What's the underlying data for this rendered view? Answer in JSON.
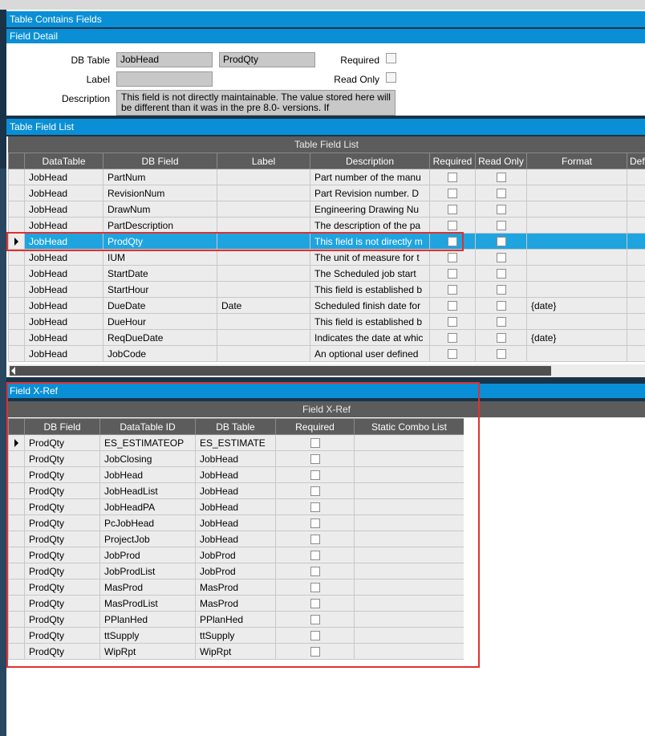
{
  "panels": {
    "main_title": "Table Contains Fields",
    "field_detail_title": "Field Detail",
    "table_field_list_title": "Table Field List",
    "field_xref_title": "Field X-Ref"
  },
  "field_detail": {
    "db_table_label": "DB Table",
    "db_table_value": "JobHead",
    "db_field_value": "ProdQty",
    "label_label": "Label",
    "label_value": "",
    "required_label": "Required",
    "read_only_label": "Read Only",
    "description_label": "Description",
    "description_value": "This field is not directly maintainable. The value stored here will be different than it was in the pre 8.0- versions. If"
  },
  "table_field_list": {
    "band_title": "Table Field List",
    "columns": [
      "DataTable",
      "DB Field",
      "Label",
      "Description",
      "Required",
      "Read Only",
      "Format",
      "Def"
    ],
    "rows": [
      {
        "datatable": "JobHead",
        "dbfield": "PartNum",
        "label": "",
        "description": "Part number of the manu",
        "format": ""
      },
      {
        "datatable": "JobHead",
        "dbfield": "RevisionNum",
        "label": "",
        "description": "Part Revision number.  D",
        "format": ""
      },
      {
        "datatable": "JobHead",
        "dbfield": "DrawNum",
        "label": "",
        "description": "Engineering Drawing Nu",
        "format": ""
      },
      {
        "datatable": "JobHead",
        "dbfield": "PartDescription",
        "label": "",
        "description": "The description of the pa",
        "format": ""
      },
      {
        "datatable": "JobHead",
        "dbfield": "ProdQty",
        "label": "",
        "description": "This field is not directly m",
        "format": ""
      },
      {
        "datatable": "JobHead",
        "dbfield": "IUM",
        "label": "",
        "description": "The unit of measure for t",
        "format": ""
      },
      {
        "datatable": "JobHead",
        "dbfield": "StartDate",
        "label": "",
        "description": "The Scheduled job start",
        "format": ""
      },
      {
        "datatable": "JobHead",
        "dbfield": "StartHour",
        "label": "",
        "description": "This field is established b",
        "format": ""
      },
      {
        "datatable": "JobHead",
        "dbfield": "DueDate",
        "label": "Date",
        "description": "Scheduled finish date for",
        "format": "{date}"
      },
      {
        "datatable": "JobHead",
        "dbfield": "DueHour",
        "label": "",
        "description": "This field is established b",
        "format": ""
      },
      {
        "datatable": "JobHead",
        "dbfield": "ReqDueDate",
        "label": "",
        "description": "Indicates the date at whic",
        "format": "{date}"
      },
      {
        "datatable": "JobHead",
        "dbfield": "JobCode",
        "label": "",
        "description": "An optional user defined",
        "format": ""
      }
    ]
  },
  "field_xref": {
    "band_title": "Field X-Ref",
    "columns": [
      "DB Field",
      "DataTable ID",
      "DB Table",
      "Required",
      "Static Combo List"
    ],
    "rows": [
      {
        "dbfield": "ProdQty",
        "datatable_id": "ES_ESTIMATEOP",
        "dbtable": "ES_ESTIMATE"
      },
      {
        "dbfield": "ProdQty",
        "datatable_id": "JobClosing",
        "dbtable": "JobHead"
      },
      {
        "dbfield": "ProdQty",
        "datatable_id": "JobHead",
        "dbtable": "JobHead"
      },
      {
        "dbfield": "ProdQty",
        "datatable_id": "JobHeadList",
        "dbtable": "JobHead"
      },
      {
        "dbfield": "ProdQty",
        "datatable_id": "JobHeadPA",
        "dbtable": "JobHead"
      },
      {
        "dbfield": "ProdQty",
        "datatable_id": "PcJobHead",
        "dbtable": "JobHead"
      },
      {
        "dbfield": "ProdQty",
        "datatable_id": "ProjectJob",
        "dbtable": "JobHead"
      },
      {
        "dbfield": "ProdQty",
        "datatable_id": "JobProd",
        "dbtable": "JobProd"
      },
      {
        "dbfield": "ProdQty",
        "datatable_id": "JobProdList",
        "dbtable": "JobProd"
      },
      {
        "dbfield": "ProdQty",
        "datatable_id": "MasProd",
        "dbtable": "MasProd"
      },
      {
        "dbfield": "ProdQty",
        "datatable_id": "MasProdList",
        "dbtable": "MasProd"
      },
      {
        "dbfield": "ProdQty",
        "datatable_id": "PPlanHed",
        "dbtable": "PPlanHed"
      },
      {
        "dbfield": "ProdQty",
        "datatable_id": "ttSupply",
        "dbtable": "ttSupply"
      },
      {
        "dbfield": "ProdQty",
        "datatable_id": "WipRpt",
        "dbtable": "WipRpt"
      }
    ]
  },
  "colors": {
    "title_blue": "#0a8fd6",
    "selected_row": "#1fa4e0",
    "grid_header": "#5c5c5c",
    "highlight_box": "#e03030"
  }
}
